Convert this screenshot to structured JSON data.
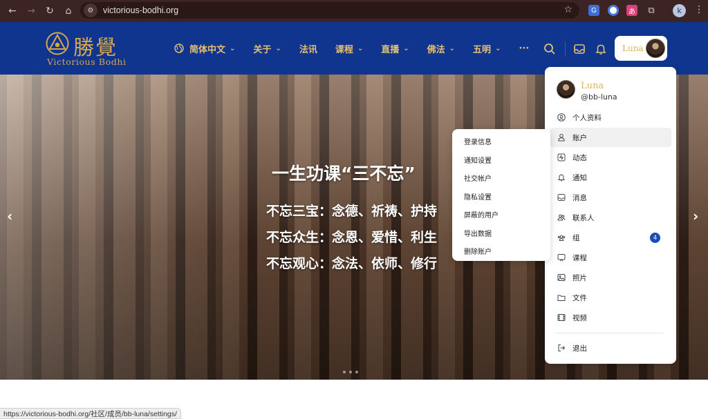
{
  "browser": {
    "url": "victorious-bodhi.org",
    "profile_initial": "k",
    "status_url": "https://victorious-bodhi.org/社区/成员/bb-luna/settings/"
  },
  "site": {
    "logo_cn": "勝覺",
    "logo_en": "Victorious Bodhi",
    "brand_color": "#10358f",
    "accent_color": "#e0b457",
    "menu": [
      {
        "label": "简体中文",
        "has_dropdown": true,
        "icon": "globe-icon"
      },
      {
        "label": "关于",
        "has_dropdown": true
      },
      {
        "label": "法讯",
        "has_dropdown": false
      },
      {
        "label": "课程",
        "has_dropdown": true
      },
      {
        "label": "直播",
        "has_dropdown": true
      },
      {
        "label": "佛法",
        "has_dropdown": true
      },
      {
        "label": "五明",
        "has_dropdown": true
      },
      {
        "label": "···",
        "has_dropdown": false
      }
    ],
    "user_name": "Luna"
  },
  "hero": {
    "title": "一生功课“三不忘”",
    "lines": [
      "不忘三宝：念德、祈祷、护持",
      "不忘众生：念恩、爱惜、利生",
      "不忘观心：念法、依师、修行"
    ]
  },
  "user_menu": {
    "name": "Luna",
    "handle": "@bb-luna",
    "items": [
      {
        "label": "个人资料",
        "icon": "user-circle-icon"
      },
      {
        "label": "账户",
        "icon": "user-icon",
        "active": true
      },
      {
        "label": "动态",
        "icon": "activity-icon"
      },
      {
        "label": "通知",
        "icon": "bell-icon"
      },
      {
        "label": "消息",
        "icon": "inbox-icon"
      },
      {
        "label": "联系人",
        "icon": "contacts-icon"
      },
      {
        "label": "组",
        "icon": "group-icon",
        "badge": "4"
      },
      {
        "label": "课程",
        "icon": "course-icon"
      },
      {
        "label": "照片",
        "icon": "photo-icon"
      },
      {
        "label": "文件",
        "icon": "folder-icon"
      },
      {
        "label": "视频",
        "icon": "video-icon"
      }
    ],
    "logout": "退出"
  },
  "account_submenu": {
    "items": [
      "登录信息",
      "通知设置",
      "社交帐户",
      "隐私设置",
      "屏蔽的用户",
      "导出数据",
      "删除账户"
    ]
  }
}
